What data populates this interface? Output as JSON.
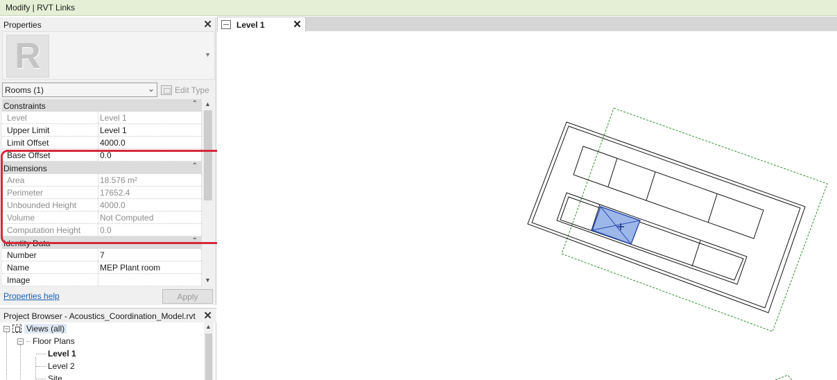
{
  "context_bar": {
    "title": "Modify | RVT Links"
  },
  "properties": {
    "title": "Properties",
    "type_selector": {
      "value": "Rooms (1)"
    },
    "edit_type_label": "Edit Type",
    "groups": [
      {
        "name": "Constraints",
        "rows": [
          {
            "key": "Level",
            "value": "Level 1",
            "readonly": true
          },
          {
            "key": "Upper Limit",
            "value": "Level 1",
            "readonly": false
          },
          {
            "key": "Limit Offset",
            "value": "4000.0",
            "readonly": false
          },
          {
            "key": "Base Offset",
            "value": "0.0",
            "readonly": false
          }
        ]
      },
      {
        "name": "Dimensions",
        "rows": [
          {
            "key": "Area",
            "value": "18.576 m²",
            "readonly": true
          },
          {
            "key": "Perimeter",
            "value": "17652.4",
            "readonly": true
          },
          {
            "key": "Unbounded Height",
            "value": "4000.0",
            "readonly": true
          },
          {
            "key": "Volume",
            "value": "Not Computed",
            "readonly": true
          },
          {
            "key": "Computation Height",
            "value": "0.0",
            "readonly": true
          }
        ]
      },
      {
        "name": "Identity Data",
        "rows": [
          {
            "key": "Number",
            "value": "7",
            "readonly": false
          },
          {
            "key": "Name",
            "value": "MEP Plant room",
            "readonly": false
          },
          {
            "key": "Image",
            "value": "",
            "readonly": false
          }
        ]
      }
    ],
    "help_link": "Properties help",
    "apply_label": "Apply"
  },
  "project_browser": {
    "title": "Project Browser - Acoustics_Coordination_Model.rvt",
    "views_label": "Views (all)",
    "floor_plans_label": "Floor Plans",
    "plans": [
      {
        "label": "Level 1",
        "bold": true
      },
      {
        "label": "Level 2",
        "bold": false
      },
      {
        "label": "Site",
        "bold": false
      }
    ]
  },
  "view_tab": {
    "label": "Level 1"
  },
  "colors": {
    "context_bar": "#e4efd5",
    "highlight": "#d6283a",
    "room_fill": "#9db7e8",
    "room_stroke": "#2c4fb3",
    "link_boundary": "#2e8b2e"
  }
}
